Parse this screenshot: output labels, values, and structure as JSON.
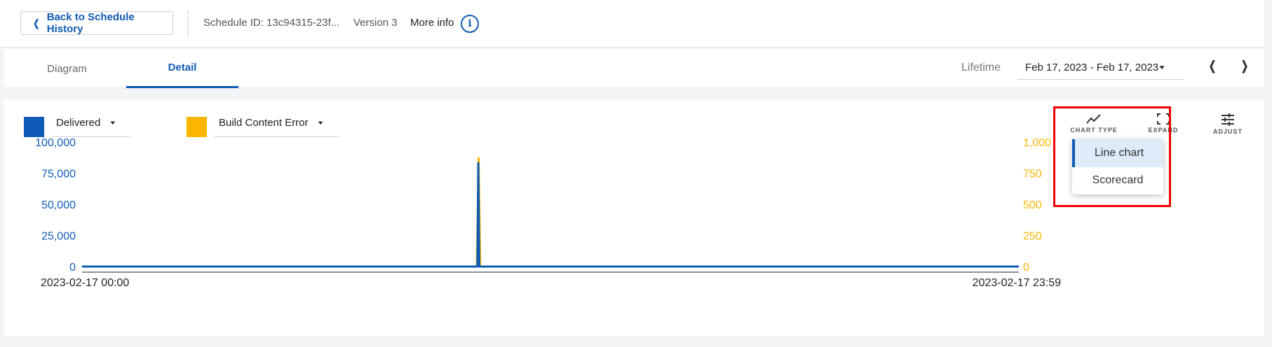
{
  "header": {
    "back_label": "Back to Schedule History",
    "schedule_id": "Schedule ID: 13c94315-23f...",
    "version": "Version 3",
    "more_info": "More info"
  },
  "tabs": {
    "items": [
      {
        "label": "Diagram",
        "active": false
      },
      {
        "label": "Detail",
        "active": true
      }
    ],
    "lifetime_label": "Lifetime",
    "date_range": "Feb 17, 2023 - Feb 17, 2023"
  },
  "legend": {
    "series1": {
      "label": "Delivered",
      "color": "#0f5bb5"
    },
    "series2": {
      "label": "Build Content Error",
      "color": "#fbb700"
    }
  },
  "toolbar": {
    "chart_type": "CHART TYPE",
    "expand": "EXPAND",
    "adjust": "ADJUST"
  },
  "chart_type_menu": {
    "items": [
      "Line chart",
      "Scorecard"
    ],
    "selected": "Line chart"
  },
  "chart_data": {
    "type": "line",
    "x_labels": [
      "2023-02-17 00:00",
      "2023-02-17 23:59"
    ],
    "left_axis": {
      "ticks": [
        0,
        25000,
        50000,
        75000,
        100000
      ],
      "tick_labels": [
        "0",
        "25,000",
        "50,000",
        "75,000",
        "100,000"
      ],
      "range": [
        0,
        100000
      ]
    },
    "right_axis": {
      "ticks": [
        0,
        250,
        500,
        750,
        1000
      ],
      "tick_labels": [
        "0",
        "250",
        "500",
        "750",
        "1,000"
      ],
      "range": [
        0,
        1000
      ]
    },
    "series": [
      {
        "name": "Delivered",
        "axis": "left",
        "color": "#0f5bb5",
        "points": [
          [
            0,
            0
          ],
          [
            0.422,
            0
          ],
          [
            0.423,
            83000
          ],
          [
            0.424,
            0
          ],
          [
            1,
            0
          ]
        ]
      },
      {
        "name": "Build Content Error",
        "axis": "right",
        "color": "#fbb700",
        "points": [
          [
            0,
            0
          ],
          [
            0.4215,
            0
          ],
          [
            0.4233,
            870
          ],
          [
            0.4251,
            0
          ],
          [
            1,
            0
          ]
        ]
      }
    ]
  }
}
